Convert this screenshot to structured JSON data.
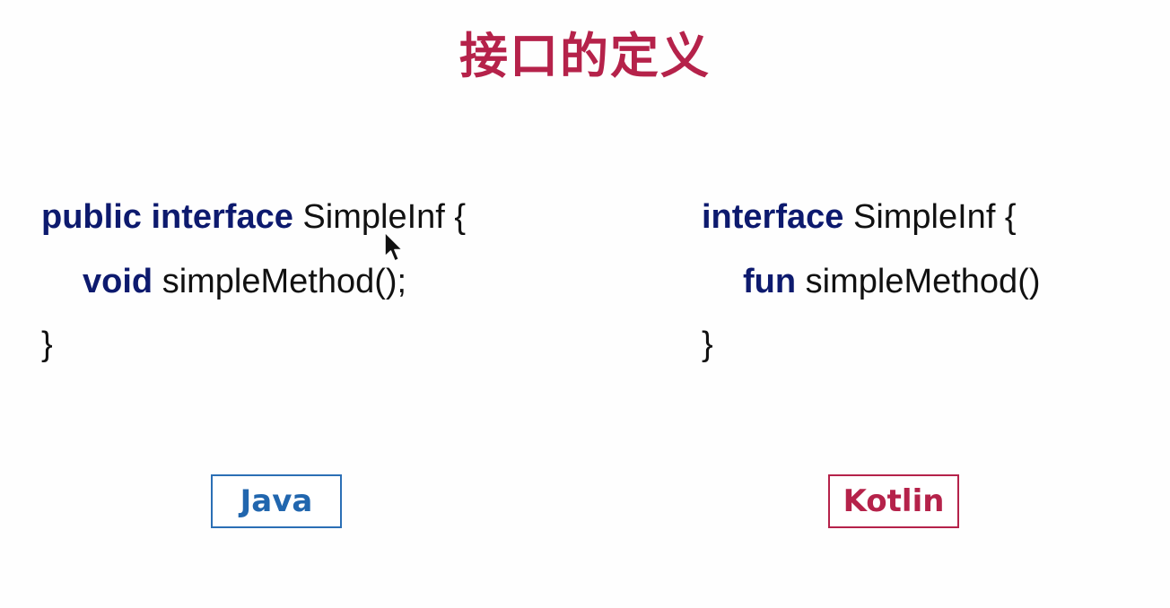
{
  "slide": {
    "title": "接口的定义"
  },
  "java": {
    "line1": {
      "kw1": "public",
      "kw2": "interface",
      "rest": "SimpleInf {"
    },
    "line2": {
      "kw": "void",
      "rest": "simpleMethod();"
    },
    "line3": "}",
    "label": "Java"
  },
  "kotlin": {
    "line1": {
      "kw": "interface",
      "rest": "SimpleInf {"
    },
    "line2": {
      "kw": "fun",
      "rest": "simpleMethod()"
    },
    "line3": "}",
    "label": "Kotlin"
  },
  "icons": {
    "cursor": "mouse-pointer-icon"
  },
  "colors": {
    "title": "#b5224a",
    "keyword": "#0d1a6e",
    "java_label": "#2166ae",
    "kotlin_label": "#b5224a"
  }
}
